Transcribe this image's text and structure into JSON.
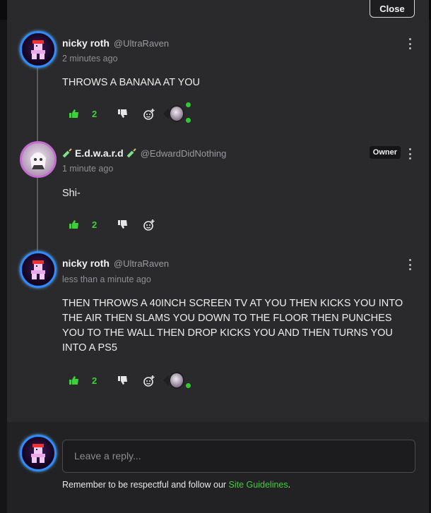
{
  "dialog": {
    "close_label": "Close"
  },
  "comments": [
    {
      "author": "nicky roth",
      "handle": "@UltraRaven",
      "time": "2 minutes ago",
      "text": "THROWS A BANANA AT YOU",
      "likes": "2"
    },
    {
      "author": "E.d.w.a.r.d",
      "handle": "@EdwardDidNothing",
      "badge": "Owner",
      "time": "1 minute ago",
      "text": "Shi-",
      "likes": "2"
    },
    {
      "author": "nicky roth",
      "handle": "@UltraRaven",
      "time": "less than a minute ago",
      "text": "THEN THROWS A 40INCH SCREEN TV AT YOU THEN KICKS YOU INTO THE AIR THEN SLAMS YOU DOWN TO THE FLOOR THEN PUNCHES YOU TO THE WALL THEN DROP KICKS YOU AND THEN TURNS YOU INTO A PS5",
      "likes": "2"
    }
  ],
  "reply": {
    "placeholder": "Leave a reply...",
    "notice_prefix": "Remember to be respectful and follow our ",
    "notice_link": "Site Guidelines",
    "notice_suffix": "."
  },
  "colors": {
    "accent_green": "#3fd13c",
    "panel": "#2a2a2c",
    "avatar_ring": "#2f8cff"
  }
}
